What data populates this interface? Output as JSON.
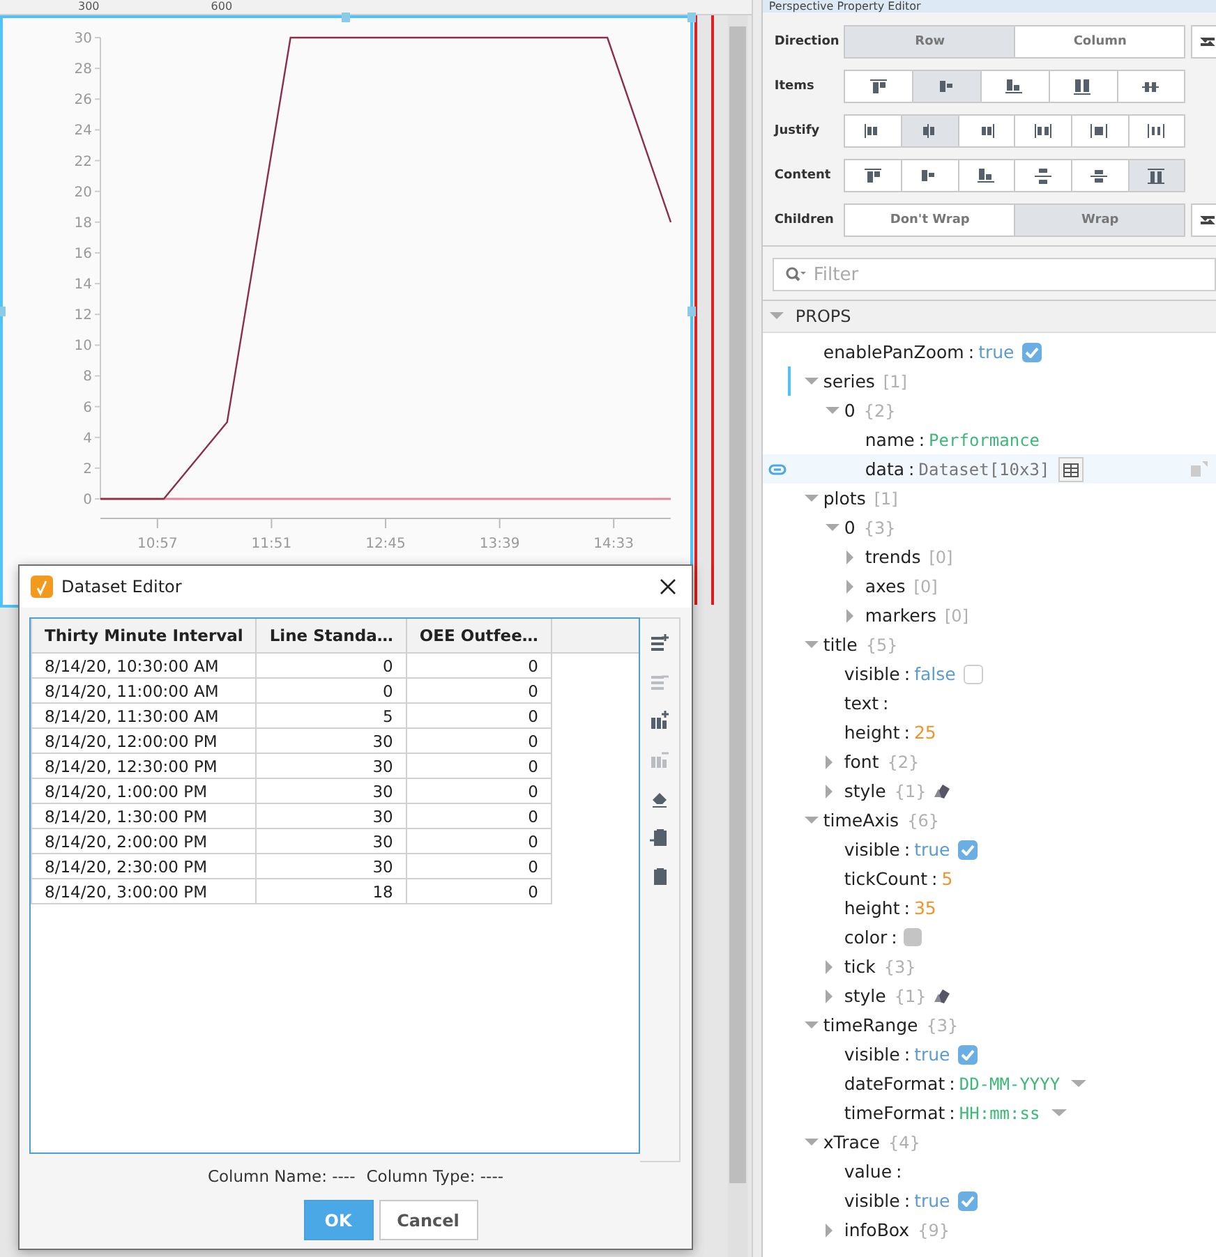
{
  "ruler": {
    "labels": [
      "300",
      "600"
    ]
  },
  "chart": {
    "chart_data": {
      "type": "line",
      "x": [
        630,
        660,
        690,
        720,
        750,
        780,
        810,
        840,
        870,
        900
      ],
      "series": [
        {
          "color": "#8b2e4a",
          "values": [
            0,
            0,
            5,
            30,
            30,
            30,
            30,
            30,
            30,
            18
          ]
        },
        {
          "color": "#e08a9a",
          "values": [
            0,
            0,
            0,
            0,
            0,
            0,
            0,
            0,
            0,
            0
          ]
        }
      ],
      "xlim": [
        630,
        900
      ],
      "ylim": [
        0,
        30
      ],
      "xticks": [
        {
          "value": 657,
          "label": "10:57"
        },
        {
          "value": 711,
          "label": "11:51"
        },
        {
          "value": 765,
          "label": "12:45"
        },
        {
          "value": 819,
          "label": "13:39"
        },
        {
          "value": 873,
          "label": "14:33"
        }
      ],
      "yticks": [
        0,
        2,
        4,
        6,
        8,
        10,
        12,
        14,
        16,
        18,
        20,
        22,
        24,
        26,
        28,
        30
      ]
    }
  },
  "dialog": {
    "title": "Dataset Editor",
    "columns": [
      "Thirty Minute Interval",
      "Line Standa…",
      "OEE Outfee…"
    ],
    "rows": [
      [
        "8/14/20, 10:30:00 AM",
        "0",
        "0"
      ],
      [
        "8/14/20, 11:00:00 AM",
        "0",
        "0"
      ],
      [
        "8/14/20, 11:30:00 AM",
        "5",
        "0"
      ],
      [
        "8/14/20, 12:00:00 PM",
        "30",
        "0"
      ],
      [
        "8/14/20, 12:30:00 PM",
        "30",
        "0"
      ],
      [
        "8/14/20, 1:00:00 PM",
        "30",
        "0"
      ],
      [
        "8/14/20, 1:30:00 PM",
        "30",
        "0"
      ],
      [
        "8/14/20, 2:00:00 PM",
        "30",
        "0"
      ],
      [
        "8/14/20, 2:30:00 PM",
        "30",
        "0"
      ],
      [
        "8/14/20, 3:00:00 PM",
        "18",
        "0"
      ]
    ],
    "tools": [
      {
        "disabled": false
      },
      {
        "disabled": true
      },
      {
        "disabled": false
      },
      {
        "disabled": true
      },
      {
        "disabled": false
      },
      {
        "disabled": false
      },
      {
        "disabled": false
      }
    ],
    "column_name": "Column Name: ----",
    "column_type": "Column Type: ----",
    "buttons": [
      {
        "label": "OK",
        "kind": "primary"
      },
      {
        "label": "Cancel",
        "kind": "secondary"
      }
    ]
  },
  "property_editor": {
    "title": "Perspective Property Editor",
    "layout_rows": [
      {
        "label": "Direction",
        "kind": "text",
        "swap": true,
        "options": [
          {
            "label": "Row",
            "selected": true
          },
          {
            "label": "Column",
            "selected": false
          }
        ]
      },
      {
        "label": "Items",
        "kind": "icons",
        "swap": false,
        "options": [
          {
            "selected": false
          },
          {
            "selected": true
          },
          {
            "selected": false
          },
          {
            "selected": false
          },
          {
            "selected": false
          }
        ]
      },
      {
        "label": "Justify",
        "kind": "icons",
        "swap": false,
        "options": [
          {
            "selected": false
          },
          {
            "selected": true
          },
          {
            "selected": false
          },
          {
            "selected": false
          },
          {
            "selected": false
          },
          {
            "selected": false
          }
        ]
      },
      {
        "label": "Content",
        "kind": "icons",
        "swap": false,
        "options": [
          {
            "selected": false
          },
          {
            "selected": false
          },
          {
            "selected": false
          },
          {
            "selected": false
          },
          {
            "selected": false
          },
          {
            "selected": true
          }
        ]
      },
      {
        "label": "Children",
        "kind": "text",
        "swap": true,
        "options": [
          {
            "label": "Don't Wrap",
            "selected": false
          },
          {
            "label": "Wrap",
            "selected": true
          }
        ]
      }
    ],
    "filter": {
      "placeholder": "Filter"
    },
    "section": {
      "label": "PROPS",
      "expanded": true
    },
    "tree": [
      {
        "key": "enablePanZoom",
        "sep": ":",
        "kind": "boolean",
        "value": "true",
        "checked": true,
        "bound": false,
        "selected": false
      },
      {
        "key": "series",
        "kind": "branch",
        "count": "[1]",
        "expanded": true,
        "bound": true,
        "selected": false,
        "children": [
          {
            "key": "0",
            "kind": "branch",
            "count": "{2}",
            "expanded": true,
            "bound": false,
            "selected": false,
            "children": [
              {
                "key": "name",
                "sep": ":",
                "kind": "string",
                "value": "Performance",
                "bound": false,
                "selected": false
              },
              {
                "key": "data",
                "sep": ":",
                "kind": "dataset",
                "value": "Dataset[10x3]",
                "bound": true,
                "selected": true
              }
            ]
          }
        ]
      },
      {
        "key": "plots",
        "kind": "branch",
        "count": "[1]",
        "expanded": true,
        "bound": false,
        "selected": false,
        "children": [
          {
            "key": "0",
            "kind": "branch",
            "count": "{3}",
            "expanded": true,
            "bound": false,
            "selected": false,
            "children": [
              {
                "key": "trends",
                "kind": "branch",
                "count": "[0]",
                "expanded": false,
                "bound": false,
                "selected": false
              },
              {
                "key": "axes",
                "kind": "branch",
                "count": "[0]",
                "expanded": false,
                "bound": false,
                "selected": false
              },
              {
                "key": "markers",
                "kind": "branch",
                "count": "[0]",
                "expanded": false,
                "bound": false,
                "selected": false
              }
            ]
          }
        ]
      },
      {
        "key": "title",
        "kind": "branch",
        "count": "{5}",
        "expanded": true,
        "bound": false,
        "selected": false,
        "children": [
          {
            "key": "visible",
            "sep": ":",
            "kind": "boolean",
            "value": "false",
            "checked": false,
            "bound": false,
            "selected": false
          },
          {
            "key": "text",
            "sep": ":",
            "kind": "string",
            "bound": false,
            "selected": false
          },
          {
            "key": "height",
            "sep": ":",
            "kind": "number",
            "value": "25",
            "bound": false,
            "selected": false
          },
          {
            "key": "font",
            "kind": "branch",
            "count": "{2}",
            "expanded": false,
            "bound": false,
            "selected": false
          },
          {
            "key": "style",
            "kind": "style",
            "count": "{1}",
            "expanded": false,
            "bound": false,
            "selected": false
          }
        ]
      },
      {
        "key": "timeAxis",
        "kind": "branch",
        "count": "{6}",
        "expanded": true,
        "bound": false,
        "selected": false,
        "children": [
          {
            "key": "visible",
            "sep": ":",
            "kind": "boolean",
            "value": "true",
            "checked": true,
            "bound": false,
            "selected": false
          },
          {
            "key": "tickCount",
            "sep": ":",
            "kind": "number",
            "value": "5",
            "bound": false,
            "selected": false
          },
          {
            "key": "height",
            "sep": ":",
            "kind": "number",
            "value": "35",
            "bound": false,
            "selected": false
          },
          {
            "key": "color",
            "sep": ":",
            "kind": "color",
            "color": "#c4c4c4",
            "bound": false,
            "selected": false
          },
          {
            "key": "tick",
            "kind": "branch",
            "count": "{3}",
            "expanded": false,
            "bound": false,
            "selected": false
          },
          {
            "key": "style",
            "kind": "style",
            "count": "{1}",
            "expanded": false,
            "bound": false,
            "selected": false
          }
        ]
      },
      {
        "key": "timeRange",
        "kind": "branch",
        "count": "{3}",
        "expanded": true,
        "bound": false,
        "selected": false,
        "children": [
          {
            "key": "visible",
            "sep": ":",
            "kind": "boolean",
            "value": "true",
            "checked": true,
            "bound": false,
            "selected": false
          },
          {
            "key": "dateFormat",
            "sep": ":",
            "kind": "enum",
            "value": "DD-MM-YYYY",
            "bound": false,
            "selected": false
          },
          {
            "key": "timeFormat",
            "sep": ":",
            "kind": "enum",
            "value": "HH:mm:ss",
            "bound": false,
            "selected": false
          }
        ]
      },
      {
        "key": "xTrace",
        "kind": "branch",
        "count": "{4}",
        "expanded": true,
        "bound": false,
        "selected": false,
        "children": [
          {
            "key": "value",
            "sep": ":",
            "kind": "string",
            "bound": false,
            "selected": false
          },
          {
            "key": "visible",
            "sep": ":",
            "kind": "boolean",
            "value": "true",
            "checked": true,
            "bound": false,
            "selected": false
          },
          {
            "key": "infoBox",
            "kind": "branch",
            "count": "{9}",
            "expanded": false,
            "bound": false,
            "selected": false
          }
        ]
      }
    ]
  }
}
